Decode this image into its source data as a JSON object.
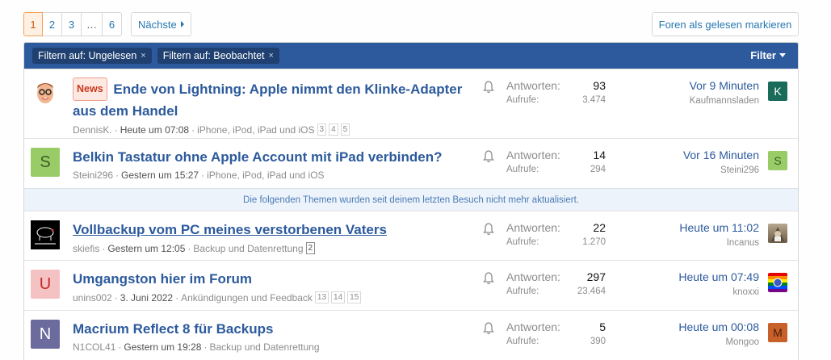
{
  "pagination": {
    "pages": [
      "1",
      "2",
      "3",
      "…",
      "6"
    ],
    "current": "1",
    "next_label": "Nächste"
  },
  "mark_read_label": "Foren als gelesen markieren",
  "filters": {
    "chips": [
      "Filtern auf: Ungelesen",
      "Filtern auf: Beobachtet"
    ],
    "remove_glyph": "×",
    "filter_label": "Filter"
  },
  "notice": "Die folgenden Themen wurden seit deinem letzten Besuch nicht mehr aktualisiert.",
  "labels": {
    "replies": "Antworten:",
    "views": "Aufrufe:"
  },
  "threads": [
    {
      "prefix": "News",
      "title": "Ende von Lightning: Apple nimmt den Klinke-Adapter aus dem Handel",
      "author": "DennisK.",
      "date": "Heute um 07:08",
      "forum": "iPhone, iPod, iPad und iOS",
      "pages": [
        "3",
        "4",
        "5"
      ],
      "replies": "93",
      "views": "3.474",
      "last_time": "Vor 9 Minuten",
      "last_user": "Kaufmannsladen",
      "avatar_letter": "",
      "avatar_color": "#ffffff",
      "last_letter": "K",
      "last_color": "#1a6b5a"
    },
    {
      "prefix": "",
      "title": "Belkin Tastatur ohne Apple Account mit iPad verbinden?",
      "author": "Steini296",
      "date": "Gestern um 15:27",
      "forum": "iPhone, iPod, iPad und iOS",
      "pages": [],
      "replies": "14",
      "views": "294",
      "last_time": "Vor 16 Minuten",
      "last_user": "Steini296",
      "avatar_letter": "S",
      "avatar_color": "#99cc66",
      "last_letter": "S",
      "last_color": "#99cc66"
    },
    {
      "prefix": "",
      "title": "Vollbackup vom PC meines verstorbenen Vaters",
      "author": "skiefis",
      "date": "Gestern um 12:05",
      "forum": "Backup und Datenrettung",
      "pages": [
        "2"
      ],
      "replies": "22",
      "views": "1.270",
      "last_time": "Heute um 11:02",
      "last_user": "Incanus",
      "avatar_letter": "",
      "avatar_color": "#000000",
      "last_letter": "",
      "last_color": "#8a7a66"
    },
    {
      "prefix": "",
      "title": "Umgangston hier im Forum",
      "author": "unins002",
      "date": "3. Juni 2022",
      "forum": "Ankündigungen und Feedback",
      "pages": [
        "13",
        "14",
        "15"
      ],
      "replies": "297",
      "views": "23.464",
      "last_time": "Heute um 07:49",
      "last_user": "knoxxi",
      "avatar_letter": "U",
      "avatar_color": "#f4c2c2",
      "last_letter": "",
      "last_color": "#ff6600"
    },
    {
      "prefix": "",
      "title": "Macrium Reflect 8 für Backups",
      "author": "N1COL41",
      "date": "Gestern um 19:28",
      "forum": "Backup und Datenrettung",
      "pages": [],
      "replies": "5",
      "views": "390",
      "last_time": "Heute um 00:08",
      "last_user": "Mongoo",
      "avatar_letter": "N",
      "avatar_color": "#6b6b9e",
      "last_letter": "M",
      "last_color": "#c8602a"
    }
  ]
}
